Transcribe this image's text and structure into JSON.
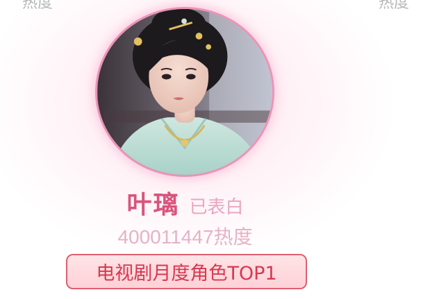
{
  "header": {
    "left_label": "热度",
    "right_label": "热度"
  },
  "profile": {
    "avatar_alt": "叶璃",
    "name": "叶璃",
    "status": "已表白",
    "heat": "400011447热度",
    "badge": "电视剧月度角色TOP1"
  },
  "colors": {
    "accent_pink": "#d9547c",
    "badge_red": "#d7384f",
    "avatar_ring": "#ec93b6"
  }
}
